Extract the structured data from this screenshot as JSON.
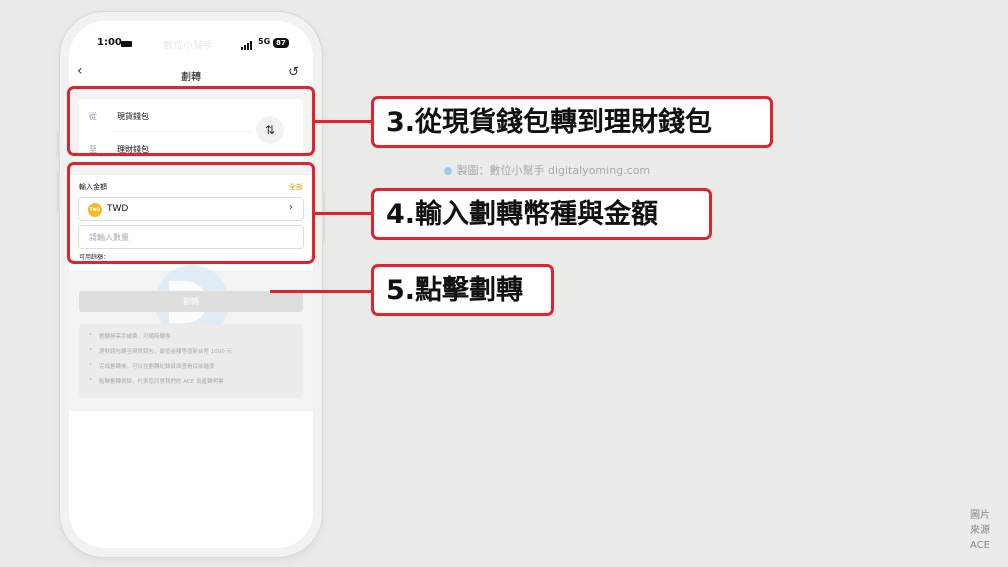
{
  "status_bar": {
    "time": "1:00",
    "watermark": "數位小幫手",
    "network": "5G",
    "battery": "87"
  },
  "nav": {
    "title": "劃轉"
  },
  "transfer": {
    "from_label": "從",
    "from_value": "現貨錢包",
    "to_label": "至",
    "to_value": "理財錢包"
  },
  "amount": {
    "label": "輸入金額",
    "all_label": "全部",
    "currency_badge": "TWD",
    "currency": "TWD",
    "quantity_placeholder": "請輸入數量",
    "available_label": "可用餘額："
  },
  "transfer_button": "劃轉",
  "notes": [
    "劃轉無需手續費，可隨時轉換",
    "理財錢包轉至現貨錢包，最低金額等值新台幣 1000 元",
    "完成劃轉後，可以在劃轉紀錄頁面查看目前進度",
    "點擊劃轉按鈕，代表您同意我們的 ACE 資產聲明書"
  ],
  "annotations": {
    "step3": "3.從現貨錢包轉到理財錢包",
    "step4": "4.輸入劃轉幣種與金額",
    "step5": "5.點擊劃轉"
  },
  "credit": "製圖：數位小幫手 digitalyoming.com",
  "source": [
    "圖片",
    "來源",
    "ACE"
  ],
  "colors": {
    "accent_red": "#e0242e",
    "gold": "#f5b921"
  },
  "icons": {
    "back": "chevron-left-icon",
    "history": "history-icon",
    "swap": "swap-arrows-icon"
  }
}
